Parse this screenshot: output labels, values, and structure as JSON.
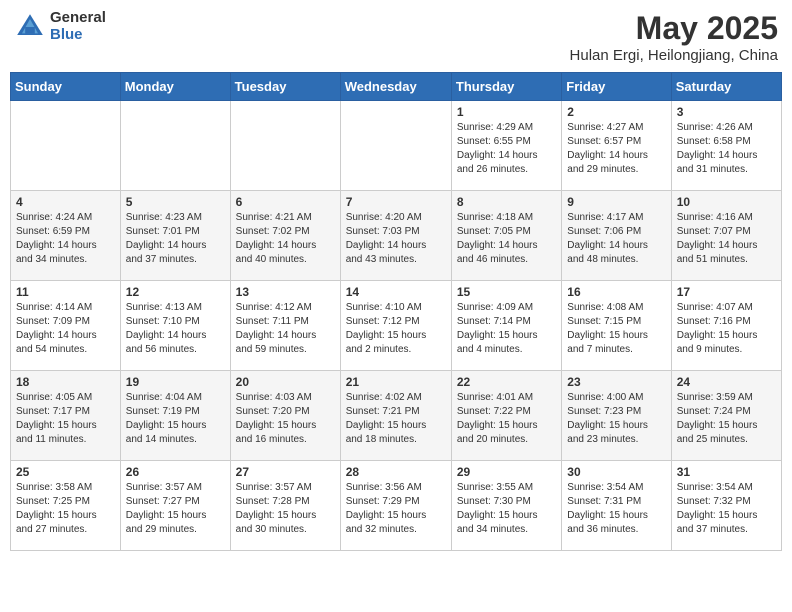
{
  "header": {
    "logo_general": "General",
    "logo_blue": "Blue",
    "month_title": "May 2025",
    "location": "Hulan Ergi, Heilongjiang, China"
  },
  "weekdays": [
    "Sunday",
    "Monday",
    "Tuesday",
    "Wednesday",
    "Thursday",
    "Friday",
    "Saturday"
  ],
  "weeks": [
    [
      {
        "day": "",
        "info": ""
      },
      {
        "day": "",
        "info": ""
      },
      {
        "day": "",
        "info": ""
      },
      {
        "day": "",
        "info": ""
      },
      {
        "day": "1",
        "info": "Sunrise: 4:29 AM\nSunset: 6:55 PM\nDaylight: 14 hours\nand 26 minutes."
      },
      {
        "day": "2",
        "info": "Sunrise: 4:27 AM\nSunset: 6:57 PM\nDaylight: 14 hours\nand 29 minutes."
      },
      {
        "day": "3",
        "info": "Sunrise: 4:26 AM\nSunset: 6:58 PM\nDaylight: 14 hours\nand 31 minutes."
      }
    ],
    [
      {
        "day": "4",
        "info": "Sunrise: 4:24 AM\nSunset: 6:59 PM\nDaylight: 14 hours\nand 34 minutes."
      },
      {
        "day": "5",
        "info": "Sunrise: 4:23 AM\nSunset: 7:01 PM\nDaylight: 14 hours\nand 37 minutes."
      },
      {
        "day": "6",
        "info": "Sunrise: 4:21 AM\nSunset: 7:02 PM\nDaylight: 14 hours\nand 40 minutes."
      },
      {
        "day": "7",
        "info": "Sunrise: 4:20 AM\nSunset: 7:03 PM\nDaylight: 14 hours\nand 43 minutes."
      },
      {
        "day": "8",
        "info": "Sunrise: 4:18 AM\nSunset: 7:05 PM\nDaylight: 14 hours\nand 46 minutes."
      },
      {
        "day": "9",
        "info": "Sunrise: 4:17 AM\nSunset: 7:06 PM\nDaylight: 14 hours\nand 48 minutes."
      },
      {
        "day": "10",
        "info": "Sunrise: 4:16 AM\nSunset: 7:07 PM\nDaylight: 14 hours\nand 51 minutes."
      }
    ],
    [
      {
        "day": "11",
        "info": "Sunrise: 4:14 AM\nSunset: 7:09 PM\nDaylight: 14 hours\nand 54 minutes."
      },
      {
        "day": "12",
        "info": "Sunrise: 4:13 AM\nSunset: 7:10 PM\nDaylight: 14 hours\nand 56 minutes."
      },
      {
        "day": "13",
        "info": "Sunrise: 4:12 AM\nSunset: 7:11 PM\nDaylight: 14 hours\nand 59 minutes."
      },
      {
        "day": "14",
        "info": "Sunrise: 4:10 AM\nSunset: 7:12 PM\nDaylight: 15 hours\nand 2 minutes."
      },
      {
        "day": "15",
        "info": "Sunrise: 4:09 AM\nSunset: 7:14 PM\nDaylight: 15 hours\nand 4 minutes."
      },
      {
        "day": "16",
        "info": "Sunrise: 4:08 AM\nSunset: 7:15 PM\nDaylight: 15 hours\nand 7 minutes."
      },
      {
        "day": "17",
        "info": "Sunrise: 4:07 AM\nSunset: 7:16 PM\nDaylight: 15 hours\nand 9 minutes."
      }
    ],
    [
      {
        "day": "18",
        "info": "Sunrise: 4:05 AM\nSunset: 7:17 PM\nDaylight: 15 hours\nand 11 minutes."
      },
      {
        "day": "19",
        "info": "Sunrise: 4:04 AM\nSunset: 7:19 PM\nDaylight: 15 hours\nand 14 minutes."
      },
      {
        "day": "20",
        "info": "Sunrise: 4:03 AM\nSunset: 7:20 PM\nDaylight: 15 hours\nand 16 minutes."
      },
      {
        "day": "21",
        "info": "Sunrise: 4:02 AM\nSunset: 7:21 PM\nDaylight: 15 hours\nand 18 minutes."
      },
      {
        "day": "22",
        "info": "Sunrise: 4:01 AM\nSunset: 7:22 PM\nDaylight: 15 hours\nand 20 minutes."
      },
      {
        "day": "23",
        "info": "Sunrise: 4:00 AM\nSunset: 7:23 PM\nDaylight: 15 hours\nand 23 minutes."
      },
      {
        "day": "24",
        "info": "Sunrise: 3:59 AM\nSunset: 7:24 PM\nDaylight: 15 hours\nand 25 minutes."
      }
    ],
    [
      {
        "day": "25",
        "info": "Sunrise: 3:58 AM\nSunset: 7:25 PM\nDaylight: 15 hours\nand 27 minutes."
      },
      {
        "day": "26",
        "info": "Sunrise: 3:57 AM\nSunset: 7:27 PM\nDaylight: 15 hours\nand 29 minutes."
      },
      {
        "day": "27",
        "info": "Sunrise: 3:57 AM\nSunset: 7:28 PM\nDaylight: 15 hours\nand 30 minutes."
      },
      {
        "day": "28",
        "info": "Sunrise: 3:56 AM\nSunset: 7:29 PM\nDaylight: 15 hours\nand 32 minutes."
      },
      {
        "day": "29",
        "info": "Sunrise: 3:55 AM\nSunset: 7:30 PM\nDaylight: 15 hours\nand 34 minutes."
      },
      {
        "day": "30",
        "info": "Sunrise: 3:54 AM\nSunset: 7:31 PM\nDaylight: 15 hours\nand 36 minutes."
      },
      {
        "day": "31",
        "info": "Sunrise: 3:54 AM\nSunset: 7:32 PM\nDaylight: 15 hours\nand 37 minutes."
      }
    ]
  ]
}
